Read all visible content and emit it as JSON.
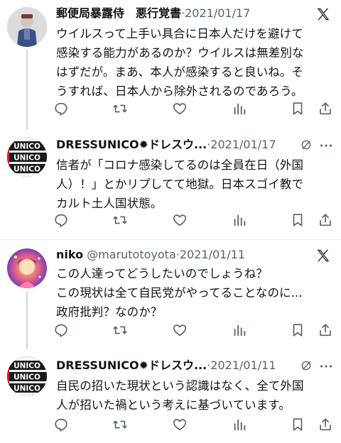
{
  "tweets": [
    {
      "name": "郵便局暴露侍　悪行覚書",
      "handle": "",
      "dot": "·",
      "date": "2021/01/17",
      "body": [
        "ウイルスって上手い具合に日本人だけを避けて",
        "感染する能力があるのか？ウイルスは無差別な",
        "はずだが。まあ、本人が感染すると良いね。そ",
        "うすれば、日本人から除外されるのであろう。"
      ]
    },
    {
      "name": "DRESSUNICO✹ドレスウ...",
      "handle": "",
      "dot": "·",
      "date": "2021/01/17",
      "body": [
        "信者が「コロナ感染してるのは全員在日（外国",
        "人）！」とかリプしてて地獄。日本スゴイ教で",
        "カルト土人国状態。"
      ]
    },
    {
      "name": "niko",
      "handle": "@marutotoyota",
      "dot": "·",
      "date": "2021/01/11",
      "body": [
        "この人達ってどうしたいのでしょうね？",
        "この現状は全て自民党がやってることなのに...",
        "政府批判？なのか？"
      ]
    },
    {
      "name": "DRESSUNICO✹ドレスウ...",
      "handle": "",
      "dot": "·",
      "date": "2021/01/11",
      "body": [
        "自民の招いた現状という認識はなく、全て外国",
        "人が招いた禍という考えに基づいています。"
      ]
    }
  ],
  "logo_text": [
    "UNICO",
    "UNICO",
    "UNICO"
  ],
  "icons": {
    "reply": "reply-icon",
    "retweet": "retweet-icon",
    "like": "heart-icon",
    "views": "views-icon",
    "bookmark": "bookmark-icon",
    "share": "share-icon",
    "x_logo": "x-logo-icon",
    "grok": "grok-icon",
    "more": "more-icon"
  },
  "colors": {
    "text": "#0f1419",
    "muted": "#536471",
    "thread_line": "#cfd9de",
    "divider": "#eff3f4"
  }
}
